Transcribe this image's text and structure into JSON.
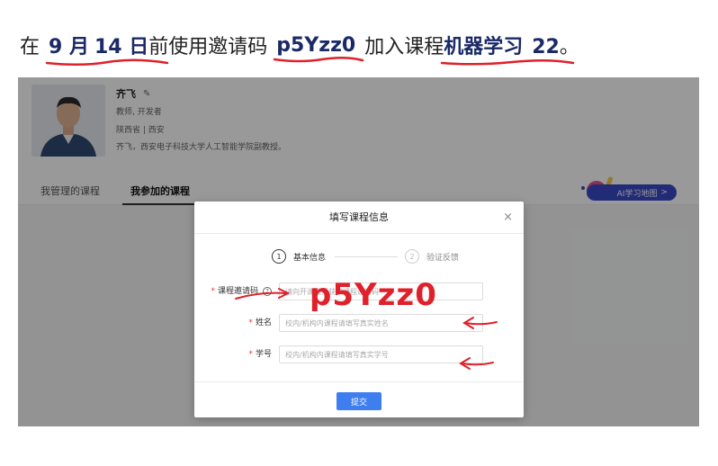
{
  "headline": {
    "prefix": "在",
    "date_month": "9 月",
    "date_day": "14 日",
    "middle": "前使用邀请码",
    "invite_code": "p5Yzz0",
    "join_text": "加入课程",
    "course_name": "机器学习",
    "course_number": "22",
    "end_punct": "。"
  },
  "profile": {
    "name": "齐飞",
    "edit_icon": "edit-icon",
    "role": "教师, 开发者",
    "location": "陕西省 | 西安",
    "bio": "齐飞，西安电子科技大学人工智能学院副教授。"
  },
  "tabs": [
    {
      "label": "我管理的课程",
      "active": false
    },
    {
      "label": "我参加的课程",
      "active": true
    }
  ],
  "ai_button": {
    "label": "AI学习地图",
    "chevron": ">"
  },
  "modal": {
    "title": "填写课程信息",
    "close_icon": "×",
    "steps": [
      {
        "number": "1",
        "label": "基本信息",
        "active": true
      },
      {
        "number": "2",
        "label": "验证反馈",
        "active": false
      }
    ],
    "fields": [
      {
        "required": "*",
        "label": "课程邀请码",
        "has_help": true,
        "help_icon": "?",
        "placeholder": "请向开课教师获取课程邀请码",
        "value": ""
      },
      {
        "required": "*",
        "label": "姓名",
        "has_help": false,
        "placeholder": "校内/机构内课程请填写真实姓名",
        "value": ""
      },
      {
        "required": "*",
        "label": "学号",
        "has_help": false,
        "placeholder": "校内/机构内课程请填写真实学号",
        "value": ""
      }
    ],
    "submit_label": "提交"
  },
  "annotation": {
    "code_text": "p5Yzz0",
    "color": "#e0202a"
  },
  "colors": {
    "headline_strong": "#1a2a66",
    "underline": "#e0202a",
    "primary": "#3f7ef0",
    "ai_button": "#3a48c6"
  }
}
